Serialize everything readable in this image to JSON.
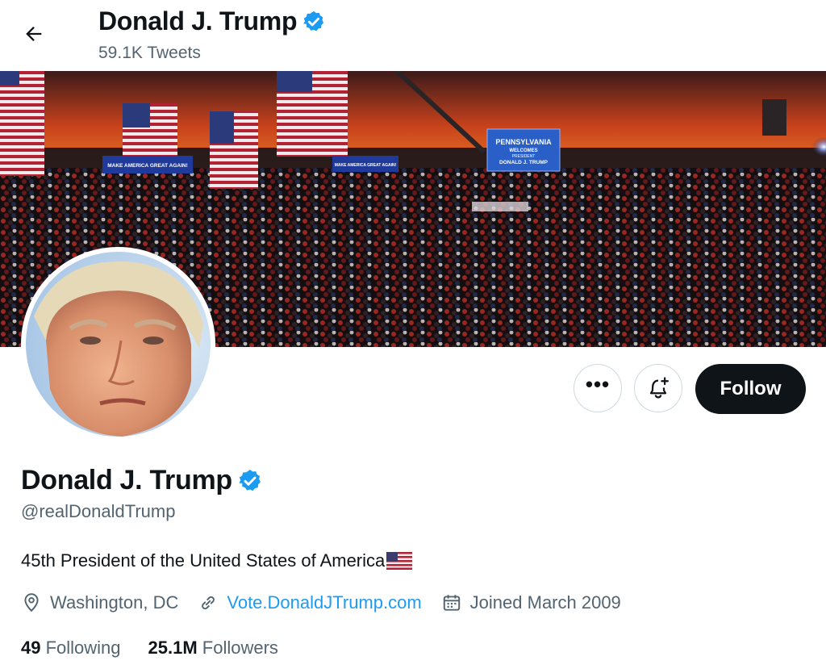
{
  "header": {
    "name": "Donald J. Trump",
    "tweet_count": "59.1K Tweets"
  },
  "banner": {
    "sign_left": "MAKE AMERICA GREAT AGAIN!",
    "sign_mid": "MAKE AMERICA GREAT AGAIN!",
    "screen_line1": "PENNSYLVANIA",
    "screen_line2": "WELCOMES",
    "screen_line3": "PRESIDENT",
    "screen_line4": "DONALD J. TRUMP"
  },
  "actions": {
    "more_label": "•••",
    "follow_label": "Follow"
  },
  "profile": {
    "name": "Donald J. Trump",
    "handle": "@realDonaldTrump",
    "bio": "45th President of the United States of America",
    "location": "Washington, DC",
    "website": "Vote.DonaldJTrump.com",
    "joined": "Joined March 2009",
    "following_count": "49",
    "following_label": "Following",
    "followers_count": "25.1M",
    "followers_label": "Followers"
  },
  "icons": {
    "back": "arrow-left-icon",
    "verified": "verified-badge-icon",
    "notify": "bell-plus-icon",
    "location": "location-pin-icon",
    "link": "link-icon",
    "calendar": "calendar-icon",
    "flag": "us-flag-icon"
  },
  "colors": {
    "verified_blue": "#1d9bf0",
    "follow_bg": "#0f1419",
    "secondary_text": "#536471",
    "link": "#1d9bf0"
  }
}
